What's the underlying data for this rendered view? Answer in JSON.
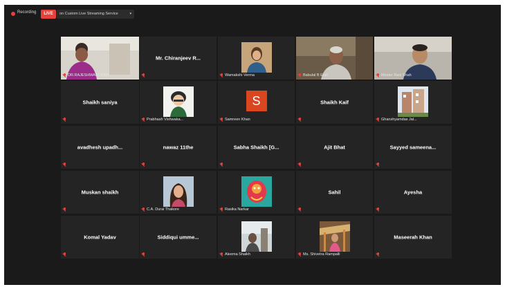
{
  "topbar": {
    "recording_label": "Recording",
    "live_label": "LIVE",
    "stream_label": "on Custom Live Streaming Service",
    "stream_caret": "▾"
  },
  "colors": {
    "background": "#1a1a1a",
    "tile": "#242424",
    "accent_red": "#e8403a",
    "active_speaker": "#e1e84a"
  },
  "participants": [
    {
      "name": "DR.RAJESHWARI RAVI",
      "view": "video",
      "active": true
    },
    {
      "name": "Mr. Chiranjeev R...",
      "view": "name"
    },
    {
      "name": "Wamakshi Verma",
      "view": "photo"
    },
    {
      "name": "Babulal B Eoci",
      "view": "video"
    },
    {
      "name": "Mester Ravi Shah",
      "view": "video"
    },
    {
      "name": "Shaikh saniya",
      "view": "name"
    },
    {
      "name": "Prabhash Vishwaka...",
      "view": "photo"
    },
    {
      "name": "Samreen Khan",
      "view": "initial",
      "initial": "S"
    },
    {
      "name": "Shaikh Kaif",
      "view": "name"
    },
    {
      "name": "Ghanshyamdas Jal...",
      "view": "photo"
    },
    {
      "name": "avadhesh upadh...",
      "view": "name"
    },
    {
      "name": "nawaz 11the",
      "view": "name"
    },
    {
      "name": "Sabha Shaikh [G...",
      "view": "name"
    },
    {
      "name": "Ajit Bhat",
      "view": "name"
    },
    {
      "name": "Sayyed sameena...",
      "view": "name"
    },
    {
      "name": "Muskan shaikh",
      "view": "name"
    },
    {
      "name": "C.A. Durai Thakore",
      "view": "photo"
    },
    {
      "name": "Rasika Narkar",
      "view": "photo"
    },
    {
      "name": "Sahil",
      "view": "name"
    },
    {
      "name": "Ayesha",
      "view": "name"
    },
    {
      "name": "Komal Yadav",
      "view": "name"
    },
    {
      "name": "Siddiqui umme...",
      "view": "name"
    },
    {
      "name": "Aleema Shaikh",
      "view": "photo"
    },
    {
      "name": "Ms. Shivetra Rampalli",
      "view": "photo"
    },
    {
      "name": "Maseerah Khan",
      "view": "name"
    }
  ]
}
